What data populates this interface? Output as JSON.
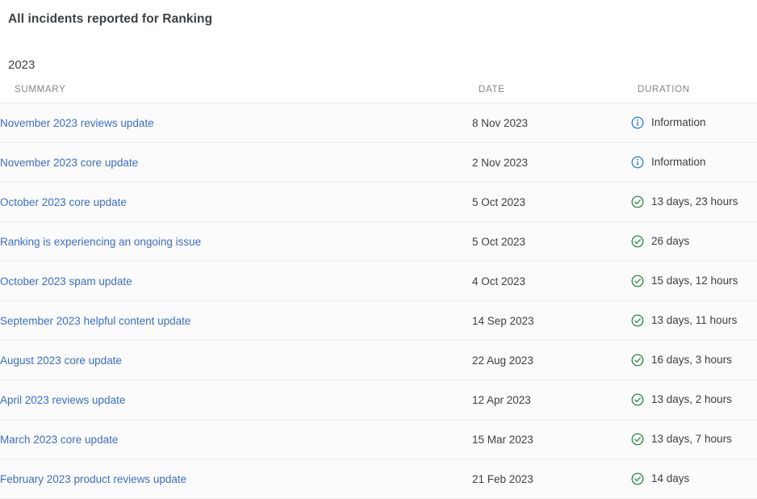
{
  "page_title": "All incidents reported for Ranking",
  "year_heading": "2023",
  "colors": {
    "link": "#3b6ec4",
    "info": "#1a73e8",
    "ok": "#188038",
    "row_bg": "#fbfbfb",
    "divider": "#eceded",
    "header_text": "#80868b"
  },
  "table": {
    "headers": {
      "summary": "SUMMARY",
      "date": "DATE",
      "duration": "DURATION"
    },
    "rows": [
      {
        "summary": "November 2023 reviews update",
        "date": "8 Nov 2023",
        "duration": "Information",
        "status_icon": "info-circle-icon"
      },
      {
        "summary": "November 2023 core update",
        "date": "2 Nov 2023",
        "duration": "Information",
        "status_icon": "info-circle-icon"
      },
      {
        "summary": "October 2023 core update",
        "date": "5 Oct 2023",
        "duration": "13 days, 23 hours",
        "status_icon": "check-circle-icon"
      },
      {
        "summary": "Ranking is experiencing an ongoing issue",
        "date": "5 Oct 2023",
        "duration": "26 days",
        "status_icon": "check-circle-icon"
      },
      {
        "summary": "October 2023 spam update",
        "date": "4 Oct 2023",
        "duration": "15 days, 12 hours",
        "status_icon": "check-circle-icon"
      },
      {
        "summary": "September 2023 helpful content update",
        "date": "14 Sep 2023",
        "duration": "13 days, 11 hours",
        "status_icon": "check-circle-icon"
      },
      {
        "summary": "August 2023 core update",
        "date": "22 Aug 2023",
        "duration": "16 days, 3 hours",
        "status_icon": "check-circle-icon"
      },
      {
        "summary": "April 2023 reviews update",
        "date": "12 Apr 2023",
        "duration": "13 days, 2 hours",
        "status_icon": "check-circle-icon"
      },
      {
        "summary": "March 2023 core update",
        "date": "15 Mar 2023",
        "duration": "13 days, 7 hours",
        "status_icon": "check-circle-icon"
      },
      {
        "summary": "February 2023 product reviews update",
        "date": "21 Feb 2023",
        "duration": "14 days",
        "status_icon": "check-circle-icon"
      }
    ]
  }
}
